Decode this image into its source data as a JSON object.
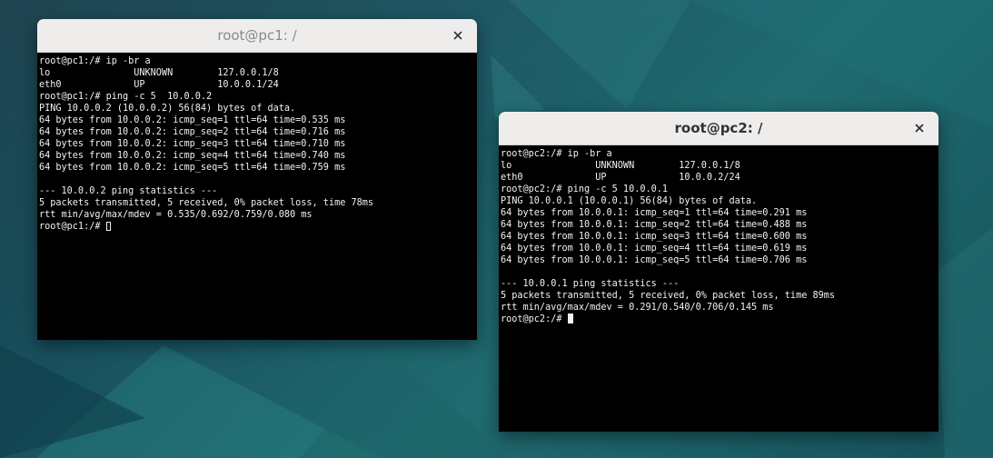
{
  "windows": [
    {
      "title": "root@pc1: /",
      "lines": [
        "root@pc1:/# ip -br a",
        "lo               UNKNOWN        127.0.0.1/8",
        "eth0             UP             10.0.0.1/24",
        "root@pc1:/# ping -c 5  10.0.0.2",
        "PING 10.0.0.2 (10.0.0.2) 56(84) bytes of data.",
        "64 bytes from 10.0.0.2: icmp_seq=1 ttl=64 time=0.535 ms",
        "64 bytes from 10.0.0.2: icmp_seq=2 ttl=64 time=0.716 ms",
        "64 bytes from 10.0.0.2: icmp_seq=3 ttl=64 time=0.710 ms",
        "64 bytes from 10.0.0.2: icmp_seq=4 ttl=64 time=0.740 ms",
        "64 bytes from 10.0.0.2: icmp_seq=5 ttl=64 time=0.759 ms",
        "",
        "--- 10.0.0.2 ping statistics ---",
        "5 packets transmitted, 5 received, 0% packet loss, time 78ms",
        "rtt min/avg/max/mdev = 0.535/0.692/0.759/0.080 ms"
      ],
      "prompt": "root@pc1:/# "
    },
    {
      "title": "root@pc2: /",
      "lines": [
        "root@pc2:/# ip -br a",
        "lo               UNKNOWN        127.0.0.1/8",
        "eth0             UP             10.0.0.2/24",
        "root@pc2:/# ping -c 5 10.0.0.1",
        "PING 10.0.0.1 (10.0.0.1) 56(84) bytes of data.",
        "64 bytes from 10.0.0.1: icmp_seq=1 ttl=64 time=0.291 ms",
        "64 bytes from 10.0.0.1: icmp_seq=2 ttl=64 time=0.488 ms",
        "64 bytes from 10.0.0.1: icmp_seq=3 ttl=64 time=0.600 ms",
        "64 bytes from 10.0.0.1: icmp_seq=4 ttl=64 time=0.619 ms",
        "64 bytes from 10.0.0.1: icmp_seq=5 ttl=64 time=0.706 ms",
        "",
        "--- 10.0.0.1 ping statistics ---",
        "5 packets transmitted, 5 received, 0% packet loss, time 89ms",
        "rtt min/avg/max/mdev = 0.291/0.540/0.706/0.145 ms"
      ],
      "prompt": "root@pc2:/# "
    }
  ],
  "icons": {
    "close": "close-icon"
  },
  "colors": {
    "terminal_bg": "#000000",
    "terminal_fg": "#f2f2f2",
    "titlebar": "#efedec"
  }
}
